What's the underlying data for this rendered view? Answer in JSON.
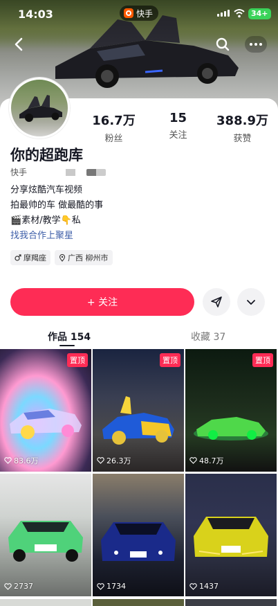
{
  "status_bar": {
    "time": "14:03",
    "app_name": "快手",
    "battery": "34+"
  },
  "profile": {
    "name": "你的超跑库",
    "id_prefix": "快手",
    "stats": [
      {
        "value": "16.7万",
        "label": "粉丝"
      },
      {
        "value": "15",
        "label": "关注"
      },
      {
        "value": "388.9万",
        "label": "获赞"
      }
    ],
    "bio_lines": [
      "分享炫酷汽车视频",
      "拍最帅的车  做最酷的事",
      "素材/教学",
      "私"
    ],
    "bio_link": "找我合作上聚星",
    "tags": [
      {
        "icon": "male-icon",
        "text": "摩羯座"
      },
      {
        "icon": "location-icon",
        "text": "广西 柳州市"
      }
    ]
  },
  "actions": {
    "follow_label": "+ 关注"
  },
  "tabs": [
    {
      "label": "作品 154"
    },
    {
      "label": "收藏 37"
    }
  ],
  "videos": [
    {
      "likes": "83.6万",
      "pinned": "置顶",
      "palette": "rainbow"
    },
    {
      "likes": "26.3万",
      "pinned": "置顶",
      "palette": "blue-yellow"
    },
    {
      "likes": "48.7万",
      "pinned": "置顶",
      "palette": "green-night"
    },
    {
      "likes": "2737",
      "pinned": "",
      "palette": "green"
    },
    {
      "likes": "1734",
      "pinned": "",
      "palette": "dark-blue"
    },
    {
      "likes": "1437",
      "pinned": "",
      "palette": "yellow"
    }
  ],
  "colors": {
    "accent": "#fe2c55",
    "link": "#3d5ea8"
  }
}
